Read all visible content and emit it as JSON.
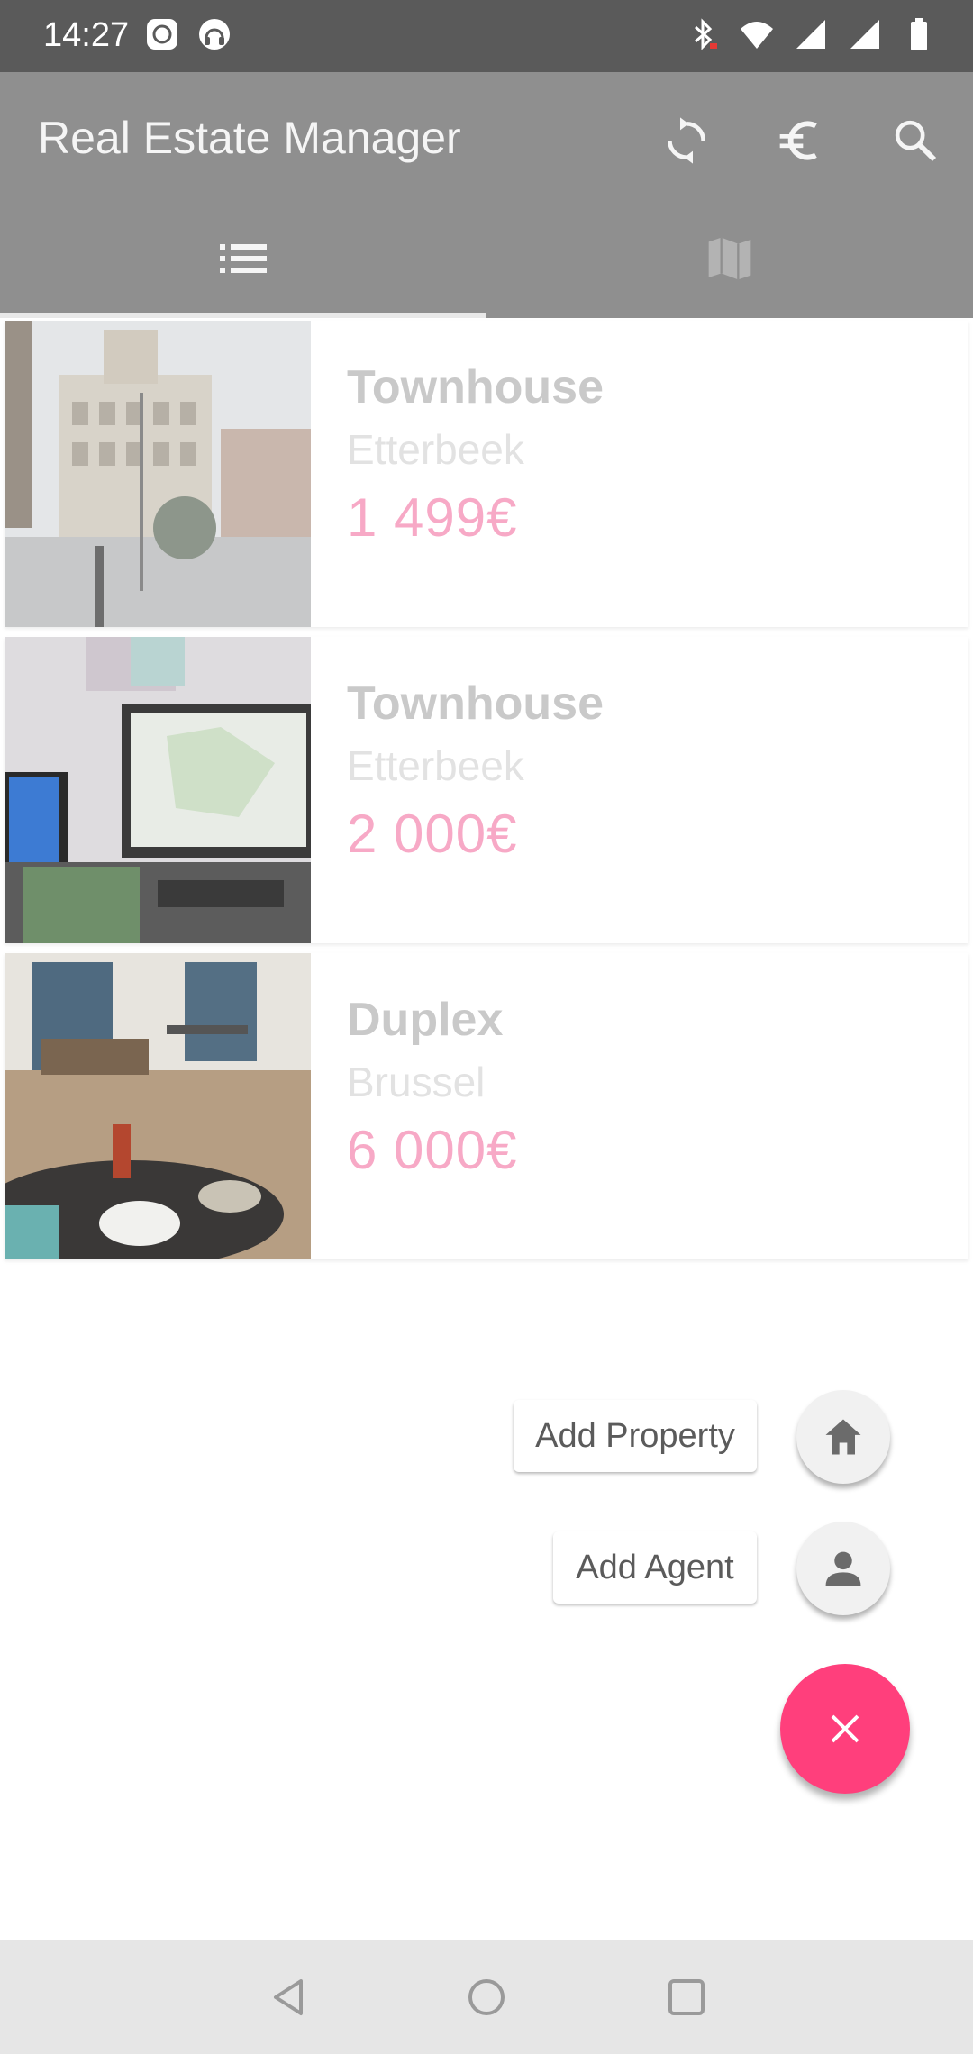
{
  "status_bar": {
    "time": "14:27",
    "left_icons": [
      "media-icon",
      "headset-icon"
    ],
    "right_icons": [
      "bluetooth-icon",
      "wifi-icon",
      "signal-icon",
      "signal-icon",
      "battery-icon"
    ]
  },
  "app_bar": {
    "title": "Real Estate Manager",
    "actions": [
      "refresh-icon",
      "euro-icon",
      "search-icon"
    ],
    "tabs": [
      {
        "icon": "list-icon",
        "selected": true
      },
      {
        "icon": "map-icon",
        "selected": false
      }
    ]
  },
  "properties": [
    {
      "type": "Townhouse",
      "city": "Etterbeek",
      "price": "1 499€",
      "photo": "street-building-photo"
    },
    {
      "type": "Townhouse",
      "city": "Etterbeek",
      "price": "2 000€",
      "photo": "desk-monitor-photo"
    },
    {
      "type": "Duplex",
      "city": "Brussel",
      "price": "6 000€",
      "photo": "dining-room-photo"
    }
  ],
  "speed_dial": {
    "add_property_label": "Add Property",
    "add_agent_label": "Add Agent",
    "main_icon": "close-icon"
  },
  "nav_bar": [
    "back-icon",
    "home-icon",
    "recents-icon"
  ],
  "colors": {
    "app_bar": "#8f8f8f",
    "status_bar": "#5a5a5a",
    "accent": "#ff3f7c",
    "price": "#f7a9c6"
  }
}
